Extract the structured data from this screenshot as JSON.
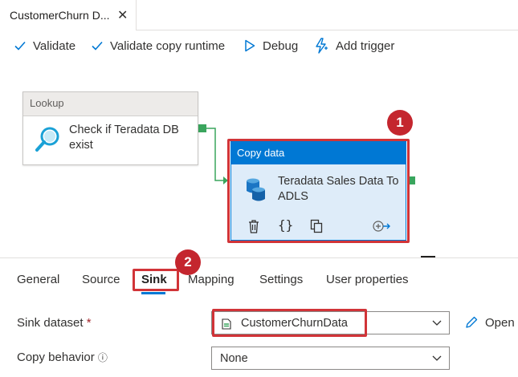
{
  "tab": {
    "title": "CustomerChurn D...",
    "close": "✕"
  },
  "toolbar": {
    "validate": "Validate",
    "validate_copy_runtime": "Validate copy runtime",
    "debug": "Debug",
    "add_trigger": "Add trigger"
  },
  "canvas": {
    "lookup": {
      "header": "Lookup",
      "text": "Check if Teradata DB exist"
    },
    "copy": {
      "header": "Copy data",
      "text": "Teradata Sales Data To ADLS"
    },
    "badges": [
      "1",
      "2"
    ]
  },
  "props": {
    "tabs": [
      "General",
      "Source",
      "Sink",
      "Mapping",
      "Settings",
      "User properties"
    ],
    "active_tab": "Sink"
  },
  "form": {
    "sink_dataset_label": "Sink dataset",
    "required_mark": "*",
    "sink_dataset_value": "CustomerChurnData",
    "open_label": "Open",
    "copy_behavior_label": "Copy behavior",
    "info_glyph": "ⓘ",
    "copy_behavior_value": "None"
  },
  "colors": {
    "accent": "#0078d4",
    "highlight": "#d13438",
    "badge": "#c4262e",
    "connector": "#3aa55d"
  }
}
